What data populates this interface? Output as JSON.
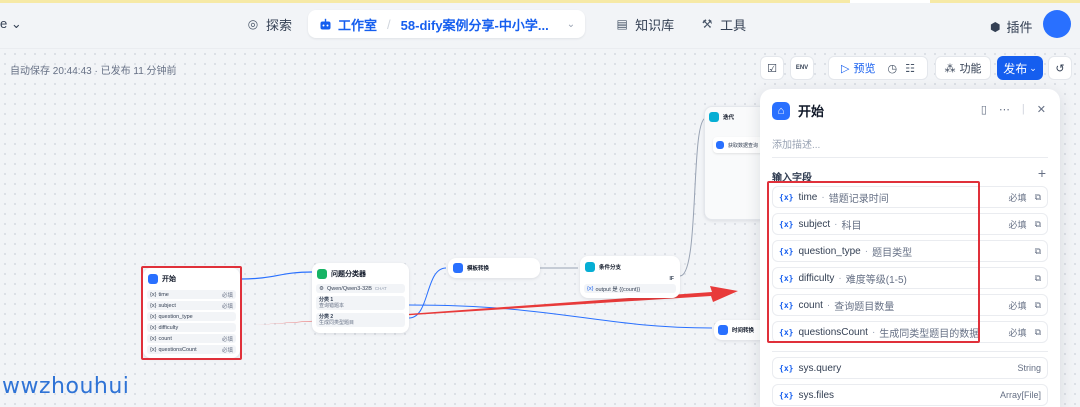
{
  "topbar": {
    "workspace_label": "e",
    "nav": {
      "explore": "探索",
      "studio": "工作室",
      "app_name": "58-dify案例分享-中小学...",
      "knowledge": "知识库",
      "tools": "工具"
    },
    "plugin": "插件"
  },
  "canvas": {
    "autosave": "自动保存 20:44:43 · 已发布 11 分钟前"
  },
  "toolbar": {
    "preview": "预览",
    "features": "功能",
    "publish": "发布",
    "env": "ENV"
  },
  "nodes": {
    "start": {
      "title": "开始",
      "fields": [
        {
          "name": "time",
          "req": "必填"
        },
        {
          "name": "subject",
          "req": "必填"
        },
        {
          "name": "question_type",
          "req": ""
        },
        {
          "name": "difficulty",
          "req": ""
        },
        {
          "name": "count",
          "req": "必填"
        },
        {
          "name": "questionsCount",
          "req": "必填"
        }
      ]
    },
    "classifier": {
      "title": "问题分类器",
      "model": "Qwen/Qwen3-32B",
      "model_tag": "CHAT",
      "class1_label": "分类 1",
      "class1_value": "查询错题本",
      "class2_label": "分类 2",
      "class2_value": "生成同类型题目"
    },
    "template": {
      "title": "模板转换"
    },
    "condition": {
      "title": "条件分支",
      "if": "IF",
      "output_text": "output 是 {{count}}"
    },
    "iteration": {
      "title": "迭代",
      "child": "获取数据查询"
    },
    "other": {
      "title": "时间转换"
    }
  },
  "panel": {
    "title": "开始",
    "description_placeholder": "添加描述...",
    "section_title": "输入字段",
    "fields": [
      {
        "name": "time",
        "label": "错题记录时间",
        "req": "必填"
      },
      {
        "name": "subject",
        "label": "科目",
        "req": "必填"
      },
      {
        "name": "question_type",
        "label": "题目类型",
        "req": ""
      },
      {
        "name": "difficulty",
        "label": "难度等级(1-5)",
        "req": ""
      },
      {
        "name": "count",
        "label": "查询题目数量",
        "req": "必填"
      },
      {
        "name": "questionsCount",
        "label": "生成同类型题目的数据",
        "req": "必填"
      }
    ],
    "sys_fields": [
      {
        "name": "sys.query",
        "type": "String"
      },
      {
        "name": "sys.files",
        "type": "Array[File]"
      }
    ],
    "var_icon": "{x}"
  },
  "watermark": "wwzhouhui",
  "colors": {
    "accent": "#155eef",
    "highlight_red": "#e0303a",
    "arrow_red": "#e83a3a"
  }
}
